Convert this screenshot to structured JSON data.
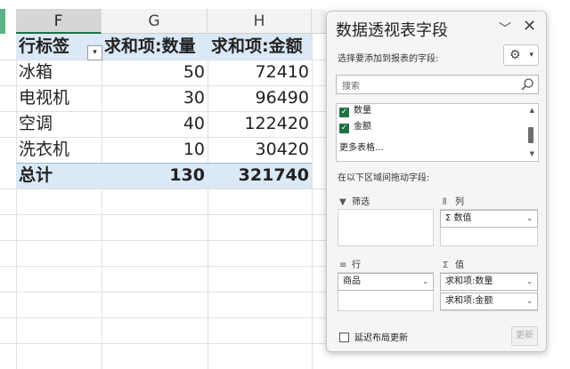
{
  "sheet": {
    "columns": [
      "F",
      "G",
      "H"
    ],
    "rows": [
      {
        "label": "行标签",
        "qty": "求和项:数量",
        "amount": "求和项:金额"
      },
      {
        "label": "冰箱",
        "qty": "50",
        "amount": "72410"
      },
      {
        "label": "电视机",
        "qty": "30",
        "amount": "96490"
      },
      {
        "label": "空调",
        "qty": "40",
        "amount": "122420"
      },
      {
        "label": "洗衣机",
        "qty": "10",
        "amount": "30420"
      },
      {
        "label": "总计",
        "qty": "130",
        "amount": "321740"
      }
    ],
    "filter_glyph": "▾"
  },
  "panel": {
    "title": "数据透视表字段",
    "collapse_glyph": "﹀",
    "close_glyph": "✕",
    "subtitle": "选择要添加到报表的字段:",
    "gear_glyph": "⚙",
    "gear_caret": "▾",
    "search_placeholder": "搜索",
    "fields": [
      {
        "label": "数量",
        "checked": true
      },
      {
        "label": "金额",
        "checked": true
      }
    ],
    "check_glyph": "✓",
    "more_tables": "更多表格...",
    "drag_label": "在以下区域间拖动字段:",
    "zones": {
      "filter": {
        "title": "筛选",
        "icon": "▼"
      },
      "columns": {
        "title": "列",
        "icon": "⫴",
        "items": [
          "Σ 数值"
        ]
      },
      "rows": {
        "title": "行",
        "icon": "≡",
        "items": [
          "商品"
        ]
      },
      "values": {
        "title": "值",
        "icon": "Σ",
        "items": [
          "求和项:数量",
          "求和项:金额"
        ]
      }
    },
    "dropdown_glyph": "⌄",
    "defer_label": "延迟布局更新",
    "update_label": "更新"
  },
  "colors": {
    "accent": "#1e7145",
    "band": "#dbe8f5",
    "selected_header": "#d6d6d6"
  }
}
